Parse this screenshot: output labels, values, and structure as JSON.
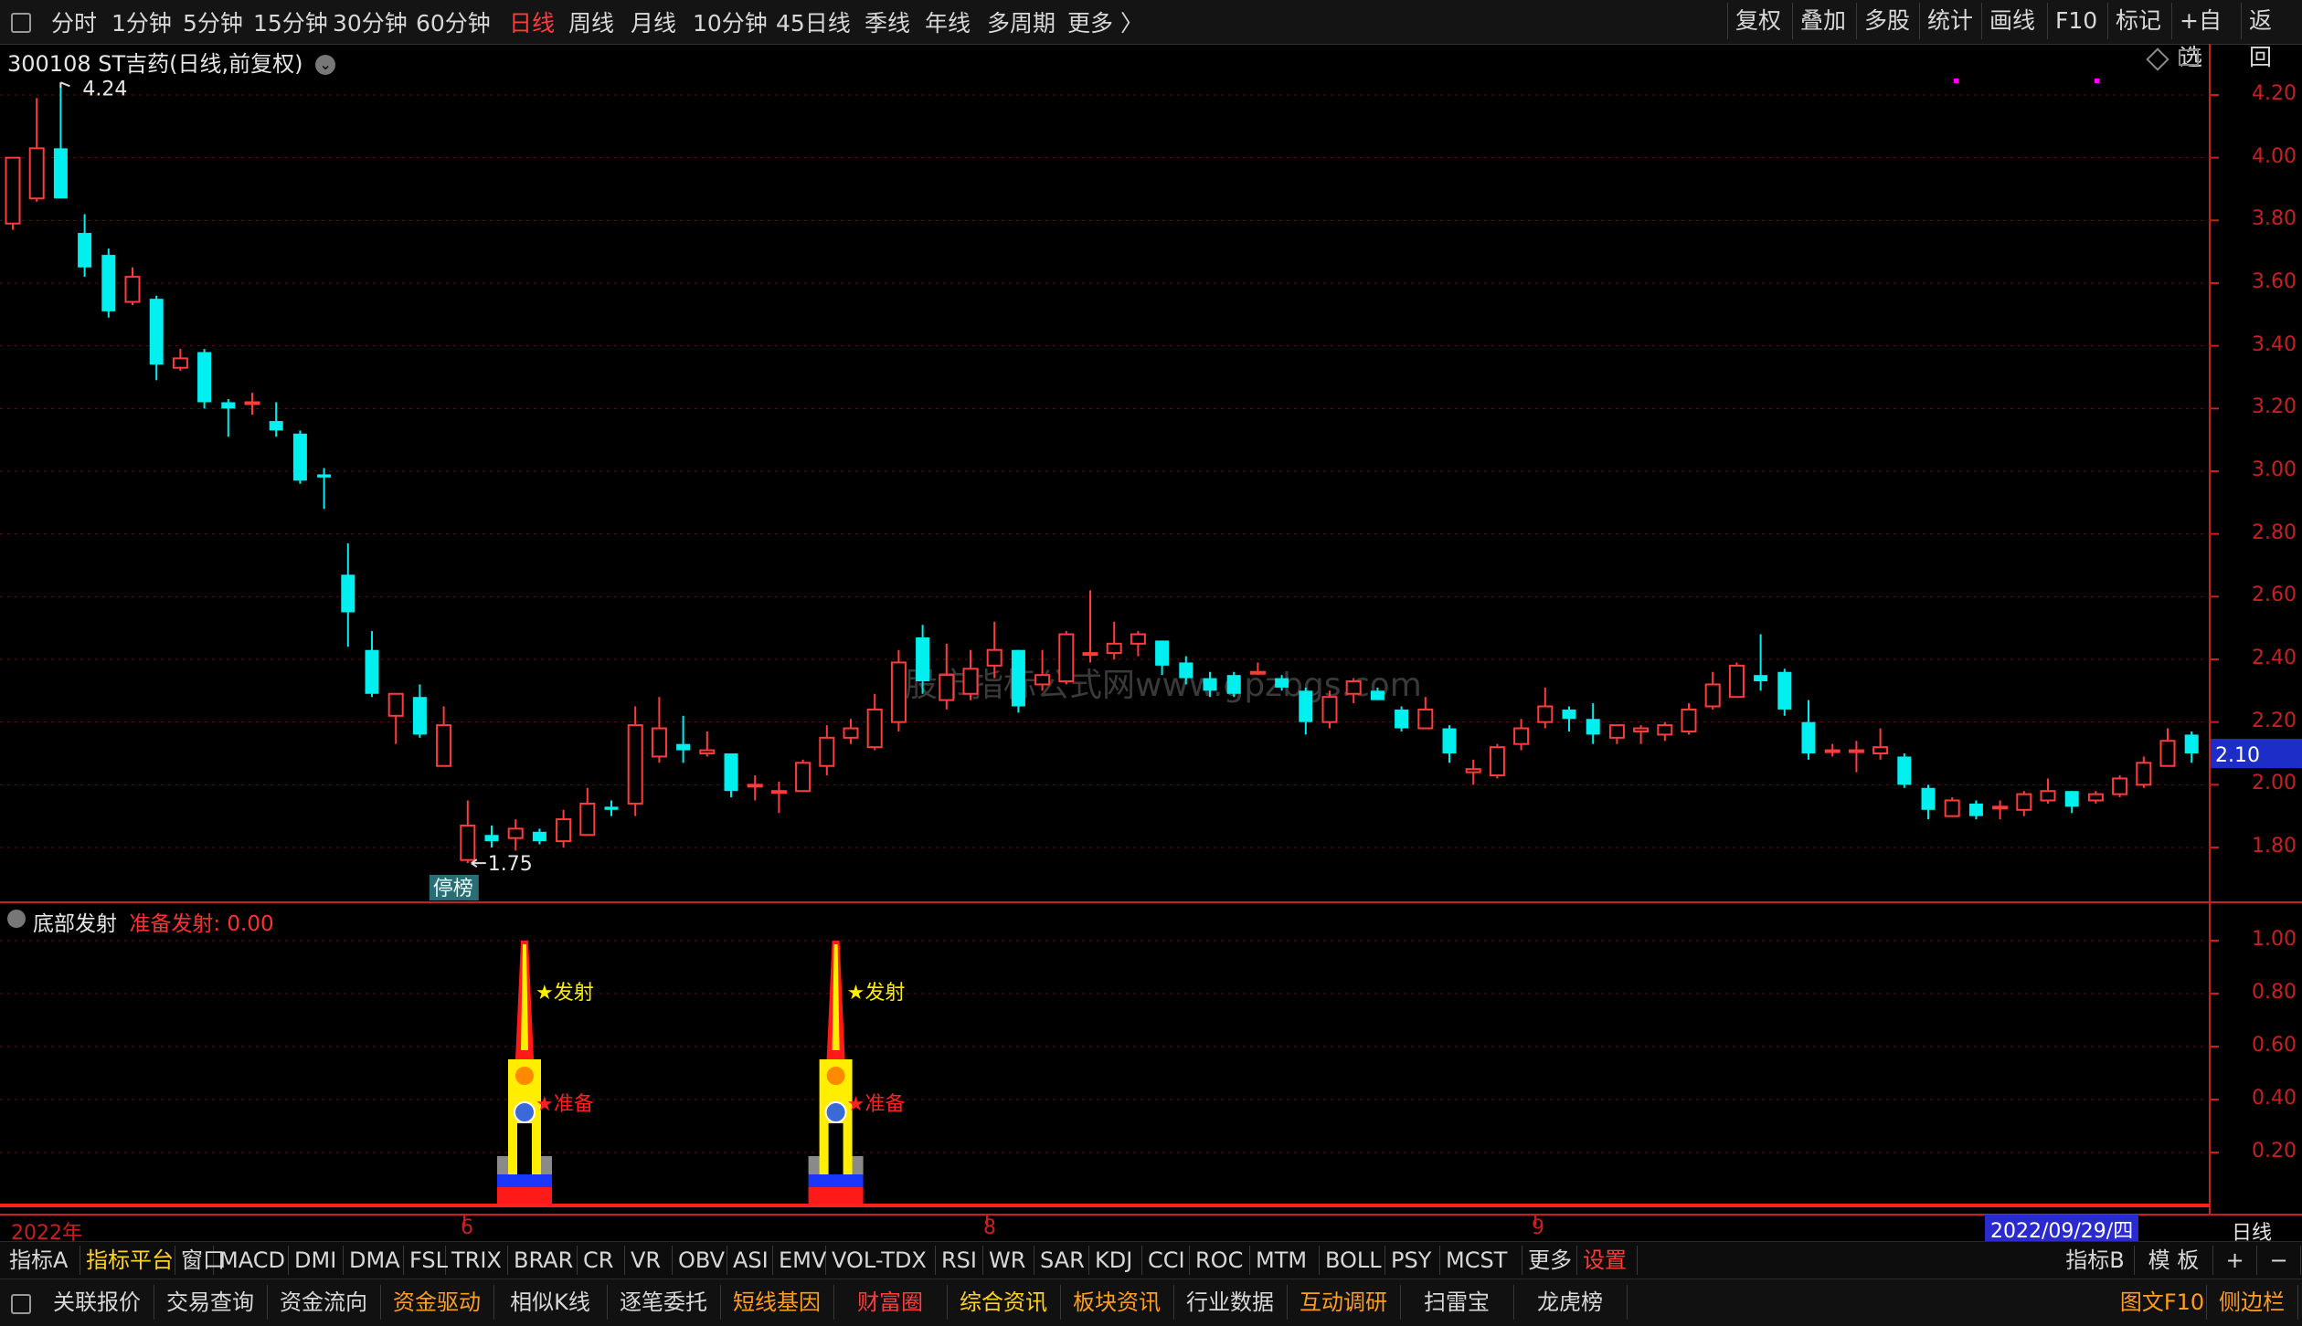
{
  "periods": [
    "分时",
    "1分钟",
    "5分钟",
    "15分钟",
    "30分钟",
    "60分钟",
    "日线",
    "周线",
    "月线",
    "10分钟",
    "45日线",
    "季线",
    "年线",
    "多周期",
    "更多 〉"
  ],
  "active_period": "日线",
  "top_right": [
    "复权",
    "叠加",
    "多股",
    "统计",
    "画线",
    "F10",
    "标记",
    "+自选",
    "返回"
  ],
  "title": "300108 ST吉药(日线,前复权)",
  "price_ticks": [
    "4.20",
    "4.00",
    "3.80",
    "3.60",
    "3.40",
    "3.20",
    "3.00",
    "2.80",
    "2.60",
    "2.40",
    "2.20",
    "2.00",
    "1.80"
  ],
  "current_price": "2.10",
  "high_label": "4.24",
  "low_label": "1.75",
  "limit_tag": "停榜",
  "watermark": "股市指标公式网www.gpzbgs.com",
  "indicator": {
    "name": "底部发射",
    "value_label": "准备发射: 0.00",
    "ticks": [
      "1.00",
      "0.80",
      "0.60",
      "0.40",
      "0.20"
    ],
    "fire_label": "★发射",
    "ready_label": "★准备"
  },
  "date_axis": {
    "labels": [
      "2022年",
      "6",
      "8",
      "9"
    ],
    "current_date": "2022/09/29/四",
    "period": "日线"
  },
  "indicator_tabs": [
    "指标A",
    "指标平台",
    "窗口",
    "MACD",
    "DMI",
    "DMA",
    "FSL",
    "TRIX",
    "BRAR",
    "CR",
    "VR",
    "OBV",
    "ASI",
    "EMV",
    "VOL-TDX",
    "RSI",
    "WR",
    "SAR",
    "KDJ",
    "CCI",
    "ROC",
    "MTM",
    "BOLL",
    "PSY",
    "MCST",
    "更多",
    "设置"
  ],
  "indicator_right": [
    "指标B",
    "模 板",
    "+",
    "−"
  ],
  "function_bar": [
    "关联报价",
    "交易查询",
    "资金流向",
    "资金驱动",
    "相似K线",
    "逐笔委托",
    "短线基因",
    "财富圈",
    "综合资讯",
    "板块资讯",
    "行业数据",
    "互动调研",
    "扫雷宝",
    "龙虎榜"
  ],
  "function_right": [
    "图文F10",
    "侧边栏"
  ],
  "colors": {
    "up": "#ff3b3b",
    "down": "#00f0f0",
    "axis": "#c82020",
    "highlight_orange": "#ff9d1e"
  },
  "chart_data": {
    "type": "candlestick",
    "ylim": [
      1.7,
      4.3
    ],
    "candles": [
      {
        "o": 3.79,
        "h": 3.9,
        "l": 3.77,
        "c": 4.0
      },
      {
        "o": 3.87,
        "h": 4.19,
        "l": 3.86,
        "c": 4.03
      },
      {
        "o": 4.03,
        "h": 4.24,
        "l": 3.87,
        "c": 3.87
      },
      {
        "o": 3.76,
        "h": 3.82,
        "l": 3.62,
        "c": 3.65
      },
      {
        "o": 3.69,
        "h": 3.71,
        "l": 3.49,
        "c": 3.51
      },
      {
        "o": 3.54,
        "h": 3.65,
        "l": 3.53,
        "c": 3.62
      },
      {
        "o": 3.55,
        "h": 3.56,
        "l": 3.29,
        "c": 3.34
      },
      {
        "o": 3.33,
        "h": 3.39,
        "l": 3.32,
        "c": 3.36
      },
      {
        "o": 3.38,
        "h": 3.39,
        "l": 3.2,
        "c": 3.22
      },
      {
        "o": 3.22,
        "h": 3.23,
        "l": 3.11,
        "c": 3.2
      },
      {
        "o": 3.22,
        "h": 3.25,
        "l": 3.18,
        "c": 3.22
      },
      {
        "o": 3.16,
        "h": 3.22,
        "l": 3.11,
        "c": 3.13
      },
      {
        "o": 3.12,
        "h": 3.13,
        "l": 2.96,
        "c": 2.97
      },
      {
        "o": 2.99,
        "h": 3.01,
        "l": 2.88,
        "c": 2.98
      },
      {
        "o": 2.67,
        "h": 2.77,
        "l": 2.44,
        "c": 2.55
      },
      {
        "o": 2.43,
        "h": 2.49,
        "l": 2.28,
        "c": 2.29
      },
      {
        "o": 2.22,
        "h": 2.28,
        "l": 2.13,
        "c": 2.29
      },
      {
        "o": 2.28,
        "h": 2.32,
        "l": 2.15,
        "c": 2.16
      },
      {
        "o": 2.06,
        "h": 2.25,
        "l": 2.06,
        "c": 2.19
      },
      {
        "o": 1.76,
        "h": 1.95,
        "l": 1.75,
        "c": 1.87
      },
      {
        "o": 1.84,
        "h": 1.87,
        "l": 1.8,
        "c": 1.82
      },
      {
        "o": 1.83,
        "h": 1.89,
        "l": 1.79,
        "c": 1.86
      },
      {
        "o": 1.85,
        "h": 1.86,
        "l": 1.81,
        "c": 1.82
      },
      {
        "o": 1.82,
        "h": 1.92,
        "l": 1.8,
        "c": 1.89
      },
      {
        "o": 1.84,
        "h": 1.99,
        "l": 1.84,
        "c": 1.94
      },
      {
        "o": 1.93,
        "h": 1.95,
        "l": 1.9,
        "c": 1.92
      },
      {
        "o": 1.94,
        "h": 2.25,
        "l": 1.9,
        "c": 2.19
      },
      {
        "o": 2.09,
        "h": 2.28,
        "l": 2.07,
        "c": 2.18
      },
      {
        "o": 2.13,
        "h": 2.22,
        "l": 2.07,
        "c": 2.11
      },
      {
        "o": 2.1,
        "h": 2.17,
        "l": 2.09,
        "c": 2.11
      },
      {
        "o": 2.1,
        "h": 2.1,
        "l": 1.96,
        "c": 1.98
      },
      {
        "o": 2.0,
        "h": 2.03,
        "l": 1.95,
        "c": 2.0
      },
      {
        "o": 1.98,
        "h": 2.01,
        "l": 1.91,
        "c": 1.98
      },
      {
        "o": 1.98,
        "h": 2.08,
        "l": 1.98,
        "c": 2.07
      },
      {
        "o": 2.06,
        "h": 2.19,
        "l": 2.03,
        "c": 2.15
      },
      {
        "o": 2.15,
        "h": 2.21,
        "l": 2.13,
        "c": 2.18
      },
      {
        "o": 2.12,
        "h": 2.29,
        "l": 2.11,
        "c": 2.24
      },
      {
        "o": 2.2,
        "h": 2.43,
        "l": 2.17,
        "c": 2.39
      },
      {
        "o": 2.47,
        "h": 2.51,
        "l": 2.29,
        "c": 2.33
      },
      {
        "o": 2.27,
        "h": 2.45,
        "l": 2.24,
        "c": 2.35
      },
      {
        "o": 2.29,
        "h": 2.43,
        "l": 2.27,
        "c": 2.37
      },
      {
        "o": 2.38,
        "h": 2.52,
        "l": 2.34,
        "c": 2.43
      },
      {
        "o": 2.43,
        "h": 2.43,
        "l": 2.23,
        "c": 2.25
      },
      {
        "o": 2.32,
        "h": 2.43,
        "l": 2.3,
        "c": 2.35
      },
      {
        "o": 2.33,
        "h": 2.49,
        "l": 2.32,
        "c": 2.48
      },
      {
        "o": 2.42,
        "h": 2.62,
        "l": 2.39,
        "c": 2.42
      },
      {
        "o": 2.42,
        "h": 2.52,
        "l": 2.4,
        "c": 2.45
      },
      {
        "o": 2.45,
        "h": 2.49,
        "l": 2.41,
        "c": 2.48
      },
      {
        "o": 2.46,
        "h": 2.46,
        "l": 2.35,
        "c": 2.38
      },
      {
        "o": 2.39,
        "h": 2.41,
        "l": 2.32,
        "c": 2.34
      },
      {
        "o": 2.34,
        "h": 2.36,
        "l": 2.28,
        "c": 2.3
      },
      {
        "o": 2.35,
        "h": 2.36,
        "l": 2.28,
        "c": 2.29
      },
      {
        "o": 2.36,
        "h": 2.39,
        "l": 2.35,
        "c": 2.36
      },
      {
        "o": 2.34,
        "h": 2.35,
        "l": 2.3,
        "c": 2.31
      },
      {
        "o": 2.3,
        "h": 2.31,
        "l": 2.16,
        "c": 2.2
      },
      {
        "o": 2.2,
        "h": 2.3,
        "l": 2.18,
        "c": 2.28
      },
      {
        "o": 2.29,
        "h": 2.34,
        "l": 2.26,
        "c": 2.33
      },
      {
        "o": 2.3,
        "h": 2.31,
        "l": 2.27,
        "c": 2.27
      },
      {
        "o": 2.24,
        "h": 2.25,
        "l": 2.17,
        "c": 2.18
      },
      {
        "o": 2.18,
        "h": 2.28,
        "l": 2.18,
        "c": 2.24
      },
      {
        "o": 2.18,
        "h": 2.19,
        "l": 2.07,
        "c": 2.1
      },
      {
        "o": 2.04,
        "h": 2.08,
        "l": 2.0,
        "c": 2.05
      },
      {
        "o": 2.03,
        "h": 2.13,
        "l": 2.02,
        "c": 2.12
      },
      {
        "o": 2.13,
        "h": 2.21,
        "l": 2.11,
        "c": 2.18
      },
      {
        "o": 2.2,
        "h": 2.31,
        "l": 2.18,
        "c": 2.25
      },
      {
        "o": 2.24,
        "h": 2.25,
        "l": 2.17,
        "c": 2.21
      },
      {
        "o": 2.21,
        "h": 2.26,
        "l": 2.13,
        "c": 2.16
      },
      {
        "o": 2.15,
        "h": 2.19,
        "l": 2.13,
        "c": 2.19
      },
      {
        "o": 2.17,
        "h": 2.19,
        "l": 2.13,
        "c": 2.18
      },
      {
        "o": 2.16,
        "h": 2.2,
        "l": 2.14,
        "c": 2.19
      },
      {
        "o": 2.17,
        "h": 2.26,
        "l": 2.16,
        "c": 2.24
      },
      {
        "o": 2.25,
        "h": 2.36,
        "l": 2.24,
        "c": 2.32
      },
      {
        "o": 2.28,
        "h": 2.39,
        "l": 2.28,
        "c": 2.38
      },
      {
        "o": 2.35,
        "h": 2.48,
        "l": 2.3,
        "c": 2.33
      },
      {
        "o": 2.36,
        "h": 2.37,
        "l": 2.22,
        "c": 2.24
      },
      {
        "o": 2.2,
        "h": 2.27,
        "l": 2.08,
        "c": 2.1
      },
      {
        "o": 2.11,
        "h": 2.13,
        "l": 2.09,
        "c": 2.11
      },
      {
        "o": 2.11,
        "h": 2.14,
        "l": 2.04,
        "c": 2.11
      },
      {
        "o": 2.1,
        "h": 2.18,
        "l": 2.08,
        "c": 2.12
      },
      {
        "o": 2.09,
        "h": 2.1,
        "l": 1.99,
        "c": 2.0
      },
      {
        "o": 1.99,
        "h": 2.0,
        "l": 1.89,
        "c": 1.92
      },
      {
        "o": 1.9,
        "h": 1.96,
        "l": 1.9,
        "c": 1.95
      },
      {
        "o": 1.94,
        "h": 1.95,
        "l": 1.89,
        "c": 1.9
      },
      {
        "o": 1.93,
        "h": 1.95,
        "l": 1.89,
        "c": 1.93
      },
      {
        "o": 1.92,
        "h": 1.98,
        "l": 1.9,
        "c": 1.97
      },
      {
        "o": 1.95,
        "h": 2.02,
        "l": 1.94,
        "c": 1.98
      },
      {
        "o": 1.98,
        "h": 1.98,
        "l": 1.91,
        "c": 1.93
      },
      {
        "o": 1.95,
        "h": 1.98,
        "l": 1.94,
        "c": 1.97
      },
      {
        "o": 1.97,
        "h": 2.03,
        "l": 1.96,
        "c": 2.02
      },
      {
        "o": 2.0,
        "h": 2.09,
        "l": 1.99,
        "c": 2.07
      },
      {
        "o": 2.06,
        "h": 2.18,
        "l": 2.06,
        "c": 2.14
      },
      {
        "o": 2.16,
        "h": 2.17,
        "l": 2.07,
        "c": 2.1
      }
    ],
    "signals": [
      {
        "index": 20,
        "value": 1.0
      },
      {
        "index": 33,
        "value": 1.0
      }
    ]
  }
}
